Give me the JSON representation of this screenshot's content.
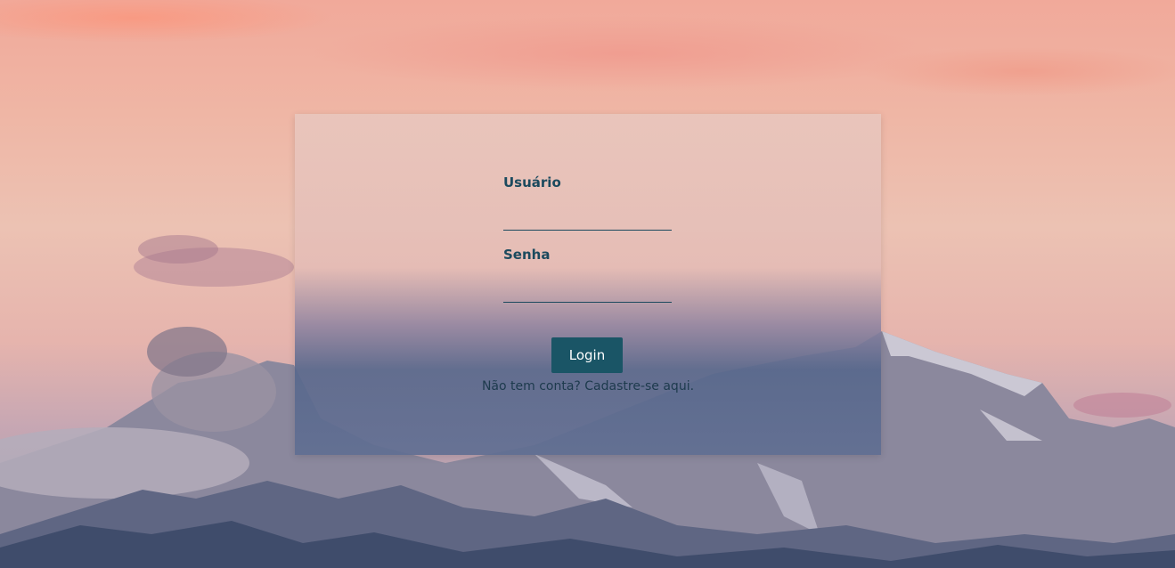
{
  "login_form": {
    "username_label": "Usuário",
    "username_value": "",
    "password_label": "Senha",
    "password_value": "",
    "login_button": "Login",
    "signup_link": "Não tem conta? Cadastre-se aqui."
  },
  "colors": {
    "accent": "#1a5566",
    "label_text": "#1b4a5e"
  }
}
